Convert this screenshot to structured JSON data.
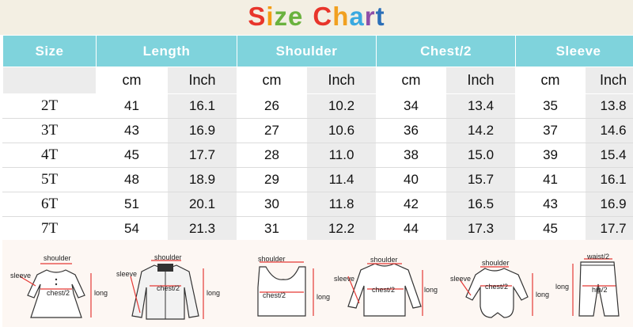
{
  "title": {
    "letters": [
      {
        "ch": "S",
        "color": "#e8352b"
      },
      {
        "ch": "i",
        "color": "#f39c12"
      },
      {
        "ch": "z",
        "color": "#6ab23e"
      },
      {
        "ch": "e",
        "color": "#6ab23e"
      },
      {
        "ch": " ",
        "color": "#ffffff"
      },
      {
        "ch": "C",
        "color": "#e8352b"
      },
      {
        "ch": "h",
        "color": "#f1a020"
      },
      {
        "ch": "a",
        "color": "#3aa9e0"
      },
      {
        "ch": "r",
        "color": "#8e4ea8"
      },
      {
        "ch": "t",
        "color": "#2b6fb8"
      }
    ]
  },
  "colors": {
    "header_bg": "#7fd3dc",
    "shade": "#ececec",
    "arrow": "#e53935"
  },
  "table": {
    "headers": [
      "Size",
      "Length",
      "Shoulder",
      "Chest/2",
      "Sleeve"
    ],
    "units": [
      "cm",
      "Inch",
      "cm",
      "Inch",
      "cm",
      "Inch",
      "cm",
      "Inch"
    ],
    "rows": [
      {
        "size": "2T",
        "values": [
          "41",
          "16.1",
          "26",
          "10.2",
          "34",
          "13.4",
          "35",
          "13.8"
        ]
      },
      {
        "size": "3T",
        "values": [
          "43",
          "16.9",
          "27",
          "10.6",
          "36",
          "14.2",
          "37",
          "14.6"
        ]
      },
      {
        "size": "4T",
        "values": [
          "45",
          "17.7",
          "28",
          "11.0",
          "38",
          "15.0",
          "39",
          "15.4"
        ]
      },
      {
        "size": "5T",
        "values": [
          "48",
          "18.9",
          "29",
          "11.4",
          "40",
          "15.7",
          "41",
          "16.1"
        ]
      },
      {
        "size": "6T",
        "values": [
          "51",
          "20.1",
          "30",
          "11.8",
          "42",
          "16.5",
          "43",
          "16.9"
        ]
      },
      {
        "size": "7T",
        "values": [
          "54",
          "21.3",
          "31",
          "12.2",
          "44",
          "17.3",
          "45",
          "17.7"
        ]
      }
    ]
  },
  "diagrams": [
    {
      "name": "dress",
      "labels": {
        "top": "shoulder",
        "side": "sleeve",
        "mid": "chest/2",
        "right": "long"
      }
    },
    {
      "name": "jacket",
      "labels": {
        "top": "shoulder",
        "side": "sleeve",
        "mid": "chest/2",
        "right": "long"
      }
    },
    {
      "name": "vest",
      "labels": {
        "top": "shoulder",
        "mid": "chest/2",
        "right": "long"
      }
    },
    {
      "name": "tshirt",
      "labels": {
        "top": "shoulder",
        "side": "sleeve",
        "mid": "chest/2",
        "right": "long"
      }
    },
    {
      "name": "romper",
      "labels": {
        "top": "shoulder",
        "side": "sleeve",
        "mid": "chest/2",
        "right": "long"
      }
    },
    {
      "name": "pants",
      "labels": {
        "top": "waist/2",
        "mid": "hip/2",
        "left": "long"
      }
    }
  ]
}
